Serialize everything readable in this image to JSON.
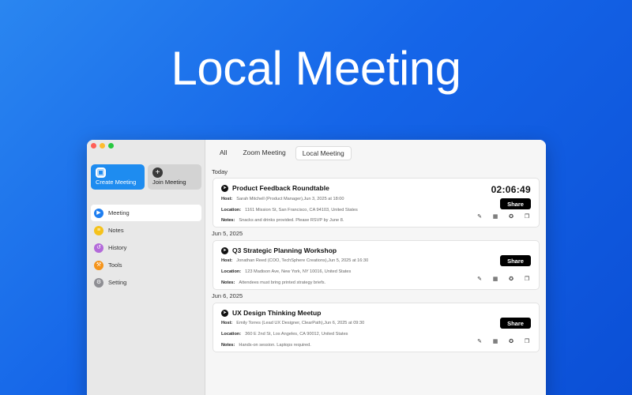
{
  "hero": {
    "title": "Local Meeting"
  },
  "sidebar": {
    "create_label": "Create Meeting",
    "join_label": "Join Meeting",
    "items": [
      {
        "label": "Meeting",
        "icon": "video-icon",
        "color": "#1e7ef0"
      },
      {
        "label": "Notes",
        "icon": "notes-icon",
        "color": "#f5c21b"
      },
      {
        "label": "History",
        "icon": "history-icon",
        "color": "#b36ad9"
      },
      {
        "label": "Tools",
        "icon": "tools-icon",
        "color": "#f5941b"
      },
      {
        "label": "Setting",
        "icon": "gear-icon",
        "color": "#8e8e93"
      }
    ]
  },
  "tabs": [
    "All",
    "Zoom Meeting",
    "Local Meeting"
  ],
  "active_tab": "Local Meeting",
  "groups": [
    {
      "date": "Today",
      "title": "Product Feedback Roundtable",
      "timer": "02:06:49",
      "host_key": "Host:",
      "host": "Sarah Mitchell (Product Manager),Jun 3, 2025 at 18:00",
      "location_key": "Location:",
      "location": "1161 Mission St, San Francisco, CA 94103, United States",
      "notes_key": "Notes:",
      "notes": "Snacks and drinks provided. Please RSVP by June 8.",
      "share": "Share"
    },
    {
      "date": "Jun 5, 2025",
      "title": "Q3 Strategic Planning Workshop",
      "host_key": "Host:",
      "host": "Jonathan Reed (COO, TechSphere Creations),Jun 5, 2025 at 16:30",
      "location_key": "Location:",
      "location": "123 Madison Ave, New York, NY 10016, United States",
      "notes_key": "Notes:",
      "notes": "Attendees must bring printed strategy briefs.",
      "share": "Share"
    },
    {
      "date": "Jun 6, 2025",
      "title": "UX Design Thinking Meetup",
      "host_key": "Host:",
      "host": "Emily Torres (Lead UX Designer, ClearPath),Jun 6, 2025 at 09:30",
      "location_key": "Location:",
      "location": "360 E 2nd St, Los Angeles, CA 90012, United States",
      "notes_key": "Notes:",
      "notes": "Hands-on session. Laptops required.",
      "share": "Share"
    }
  ]
}
